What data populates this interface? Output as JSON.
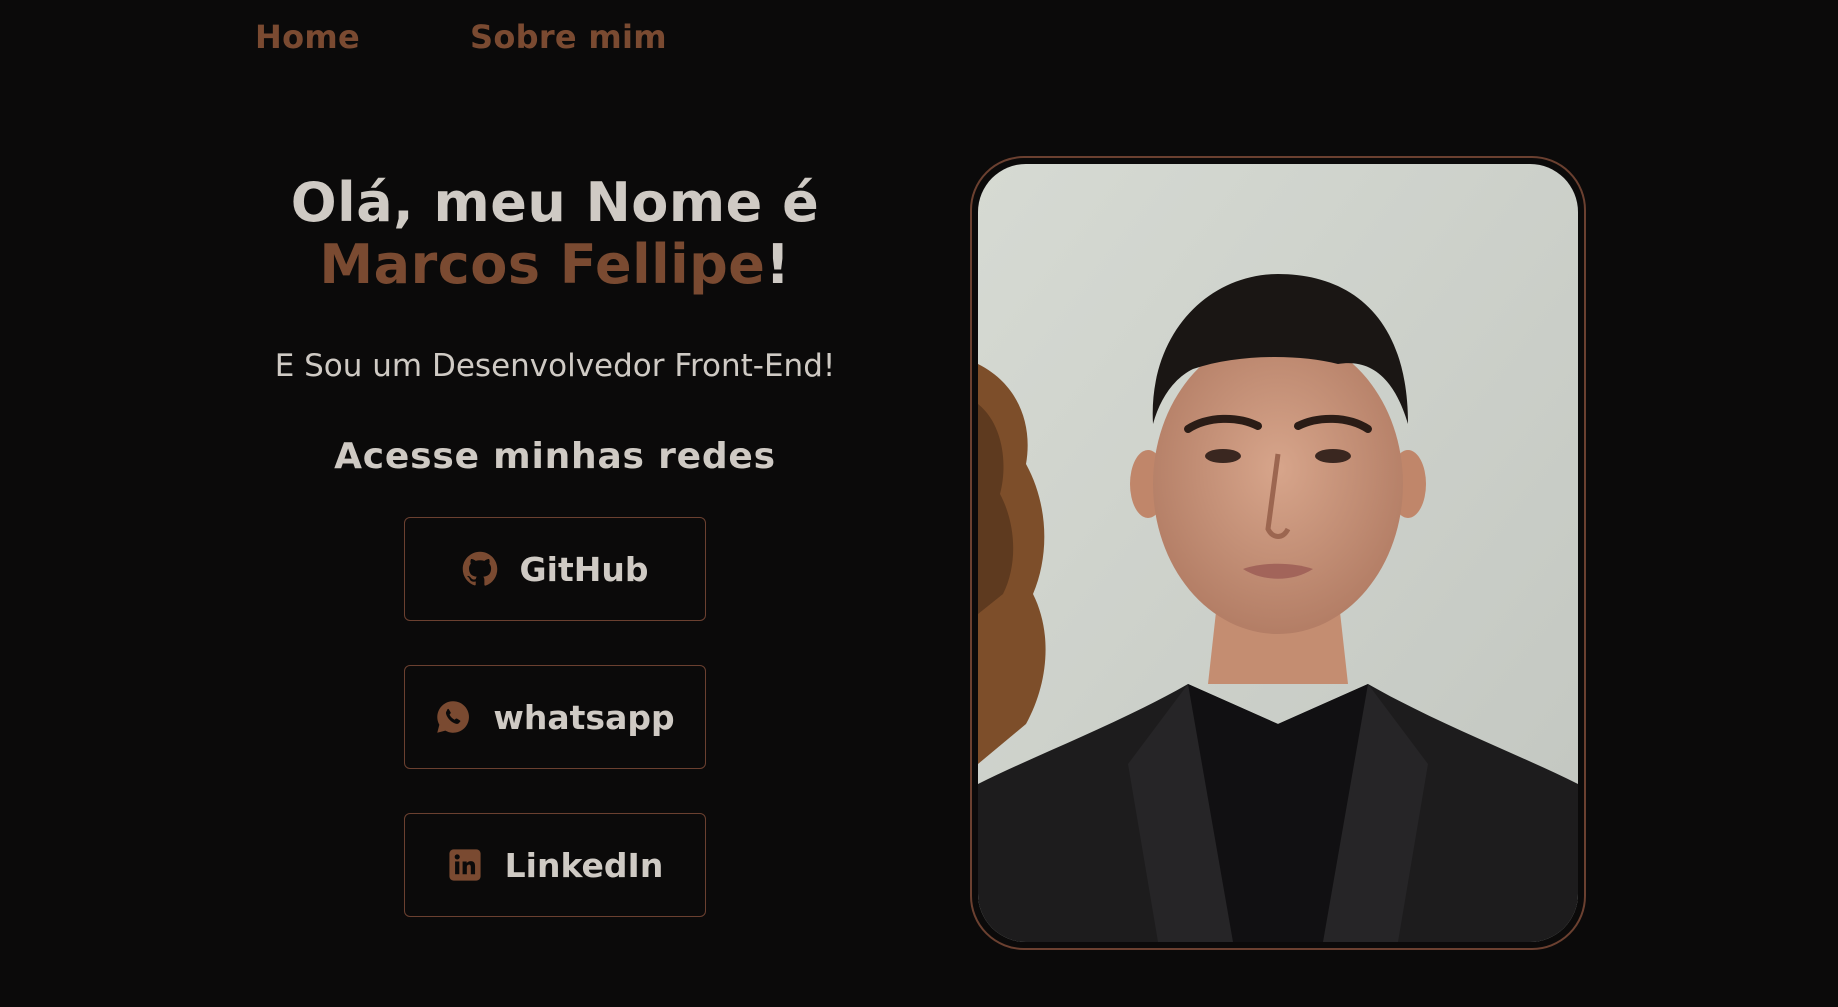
{
  "nav": {
    "items": [
      {
        "label": "Home"
      },
      {
        "label": "Sobre mim"
      }
    ]
  },
  "hero": {
    "greeting_line1": "Olá, meu Nome é",
    "name": "Marcos Fellipe",
    "exclamation": "!",
    "subtitle": "E Sou um Desenvolvedor Front-End!",
    "social_heading": "Acesse minhas redes"
  },
  "links": [
    {
      "label": "GitHub",
      "icon": "github-icon"
    },
    {
      "label": "whatsapp",
      "icon": "whatsapp-icon"
    },
    {
      "label": "LinkedIn",
      "icon": "linkedin-icon"
    }
  ],
  "colors": {
    "background": "#0b0a0a",
    "accent": "#7a4a31",
    "text": "#cfcac4",
    "border": "#6b4030"
  }
}
